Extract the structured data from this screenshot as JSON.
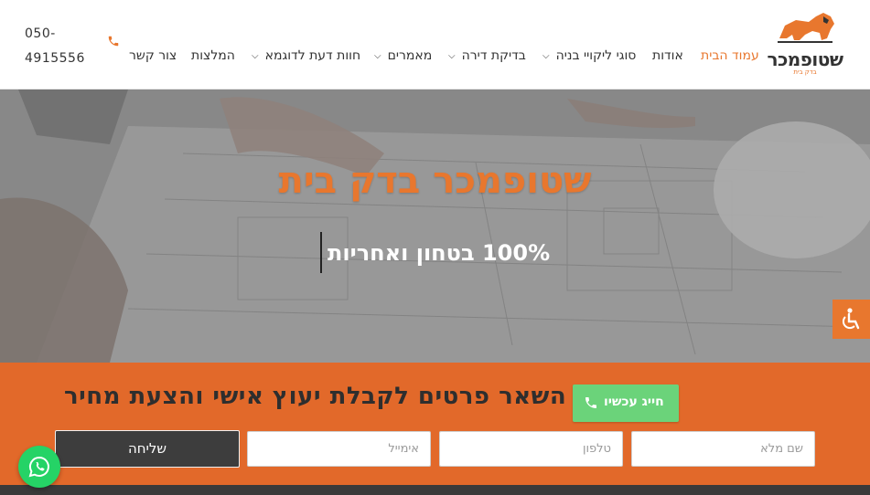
{
  "header": {
    "logo": {
      "name": "שטופמכר",
      "sub": "בדק בית"
    },
    "nav": [
      {
        "label": "עמוד הבית",
        "active": true,
        "dropdown": false
      },
      {
        "label": "אודות",
        "dropdown": false
      },
      {
        "label": "סוגי ליקויי בניה",
        "dropdown": true
      },
      {
        "label": "בדיקת דירה",
        "dropdown": true
      },
      {
        "label": "מאמרים",
        "dropdown": true
      },
      {
        "label": "חוות דעת לדוגמא",
        "dropdown": true
      },
      {
        "label": "המלצות",
        "dropdown": false
      },
      {
        "label": "צור קשר",
        "dropdown": false
      }
    ],
    "phone_line1": "050-",
    "phone_line2": "4915556",
    "phone_icon": "phone-icon"
  },
  "hero": {
    "title": "שטופמכר בדק בית",
    "subtitle": "100% בטחון ואחריות"
  },
  "lead_form": {
    "heading": "או השאר פרטים לקבלת יעוץ אישי והצעת מחיר",
    "cta_label": "חייג עכשיו",
    "fields": {
      "name_placeholder": "שם מלא",
      "phone_placeholder": "טלפון",
      "email_placeholder": "אימייל"
    },
    "submit_label": "שליחה"
  },
  "icons": {
    "accessibility": "accessibility-icon",
    "whatsapp": "whatsapp-icon"
  },
  "colors": {
    "accent": "#e8772e",
    "band": "#e2692a",
    "cta_green": "#6bd37a",
    "dark": "#3d3d3d"
  }
}
